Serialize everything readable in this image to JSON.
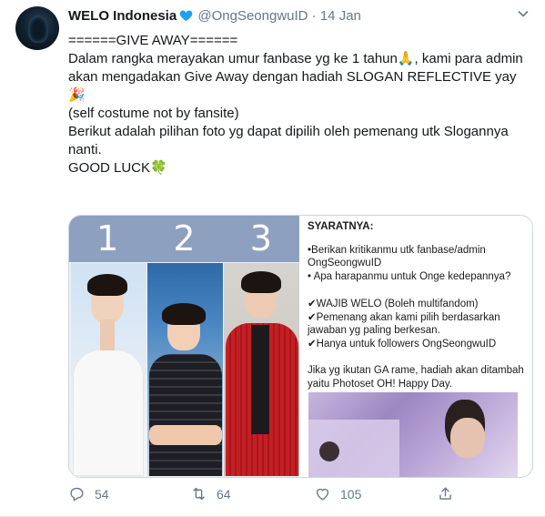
{
  "tweet": {
    "author_name": "WELO Indonesia",
    "handle": "@OngSeongwuID",
    "separator": "·",
    "date": "14 Jan",
    "lines": [
      "======GIVE AWAY======",
      "",
      "Dalam rangka merayakan umur fanbase yg ke 1 tahun🙏, kami para admin",
      "akan mengadakan Give Away dengan hadiah SLOGAN REFLECTIVE yay🎉",
      "(self costume not by fansite)",
      "",
      "Berikut adalah pilihan foto yg dapat dipilih oleh pemenang utk Slogannya",
      "nanti.",
      "",
      "GOOD LUCK🍀"
    ]
  },
  "media": {
    "numbers": [
      "1",
      "2",
      "3"
    ],
    "rules_title": "SYARATNYA:",
    "rules_lines": [
      "•Berikan kritikanmu utk fanbase/admin",
      "OngSeongwuID",
      "• Apa harapanmu untuk Onge kedepannya?",
      "✔WAJIB WELO (Boleh multifandom)",
      "✔Pemenang akan kami pilih berdasarkan",
      "jawaban yg paling berkesan.",
      "✔Hanya untuk followers OngSeongwuID",
      "Jika yg ikutan GA rame, hadiah akan ditambah",
      "yaitu Photoset OH! Happy Day."
    ]
  },
  "actions": {
    "reply_count": "54",
    "retweet_count": "64",
    "like_count": "105"
  },
  "icons": {
    "verified": "verified-badge-icon",
    "caret": "chevron-down-icon",
    "reply": "reply-icon",
    "retweet": "retweet-icon",
    "like": "heart-icon",
    "share": "share-icon"
  },
  "colors": {
    "accent": "#1da1f2",
    "muted": "#657786",
    "number_bar": "#8ea0c0"
  }
}
